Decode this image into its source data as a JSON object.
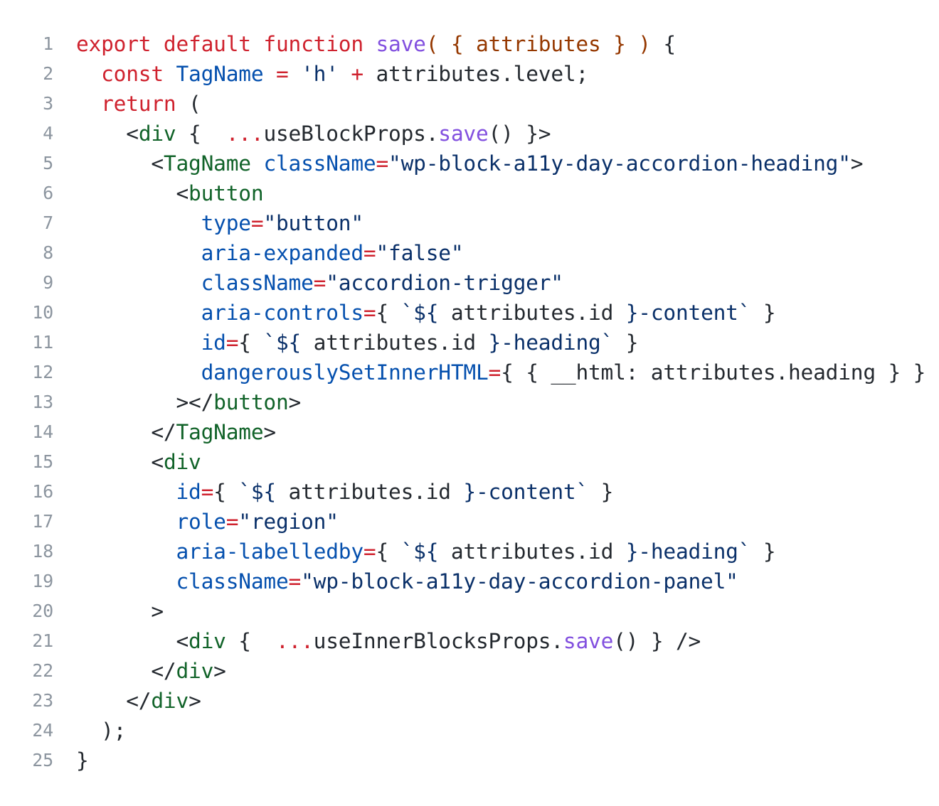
{
  "code": {
    "language": "jsx",
    "colors": {
      "kw": "#cf222e",
      "fn": "#8250df",
      "param": "#953800",
      "const": "#0550ae",
      "str": "#0a3069",
      "tag": "#116329",
      "attr": "#0550ae",
      "op": "#cf222e",
      "plain": "#24292f",
      "line_number": "#8c959f"
    },
    "lines": [
      {
        "n": "1",
        "tokens": [
          [
            "kw",
            "export default function "
          ],
          [
            "fn",
            "save"
          ],
          [
            "param",
            "( { attributes } ) "
          ],
          [
            "plain",
            "{"
          ]
        ]
      },
      {
        "n": "2",
        "tokens": [
          [
            "plain",
            "  "
          ],
          [
            "kw",
            "const "
          ],
          [
            "const",
            "TagName"
          ],
          [
            "op",
            " = "
          ],
          [
            "str",
            "'h'"
          ],
          [
            "op",
            " + "
          ],
          [
            "plain",
            "attributes.level;"
          ]
        ]
      },
      {
        "n": "3",
        "tokens": [
          [
            "plain",
            "  "
          ],
          [
            "kw",
            "return"
          ],
          [
            "plain",
            " ("
          ]
        ]
      },
      {
        "n": "4",
        "tokens": [
          [
            "plain",
            "    <"
          ],
          [
            "tag",
            "div"
          ],
          [
            "plain",
            " {  "
          ],
          [
            "op",
            "..."
          ],
          [
            "plain",
            "useBlockProps."
          ],
          [
            "fn",
            "save"
          ],
          [
            "plain",
            "() }>"
          ]
        ]
      },
      {
        "n": "5",
        "tokens": [
          [
            "plain",
            "      <"
          ],
          [
            "tag",
            "TagName"
          ],
          [
            "plain",
            " "
          ],
          [
            "attr",
            "className"
          ],
          [
            "op",
            "="
          ],
          [
            "str",
            "\"wp-block-a11y-day-accordion-heading\""
          ],
          [
            "plain",
            ">"
          ]
        ]
      },
      {
        "n": "6",
        "tokens": [
          [
            "plain",
            "        <"
          ],
          [
            "tag",
            "button"
          ]
        ]
      },
      {
        "n": "7",
        "tokens": [
          [
            "plain",
            "          "
          ],
          [
            "attr",
            "type"
          ],
          [
            "op",
            "="
          ],
          [
            "str",
            "\"button\""
          ]
        ]
      },
      {
        "n": "8",
        "tokens": [
          [
            "plain",
            "          "
          ],
          [
            "attr",
            "aria-expanded"
          ],
          [
            "op",
            "="
          ],
          [
            "str",
            "\"false\""
          ]
        ]
      },
      {
        "n": "9",
        "tokens": [
          [
            "plain",
            "          "
          ],
          [
            "attr",
            "className"
          ],
          [
            "op",
            "="
          ],
          [
            "str",
            "\"accordion-trigger\""
          ]
        ]
      },
      {
        "n": "10",
        "tokens": [
          [
            "plain",
            "          "
          ],
          [
            "attr",
            "aria-controls"
          ],
          [
            "op",
            "="
          ],
          [
            "plain",
            "{ "
          ],
          [
            "str",
            "`${"
          ],
          [
            "plain",
            " attributes.id "
          ],
          [
            "str",
            "}-content`"
          ],
          [
            "plain",
            " }"
          ]
        ]
      },
      {
        "n": "11",
        "tokens": [
          [
            "plain",
            "          "
          ],
          [
            "attr",
            "id"
          ],
          [
            "op",
            "="
          ],
          [
            "plain",
            "{ "
          ],
          [
            "str",
            "`${"
          ],
          [
            "plain",
            " attributes.id "
          ],
          [
            "str",
            "}-heading`"
          ],
          [
            "plain",
            " }"
          ]
        ]
      },
      {
        "n": "12",
        "tokens": [
          [
            "plain",
            "          "
          ],
          [
            "attr",
            "dangerouslySetInnerHTML"
          ],
          [
            "op",
            "="
          ],
          [
            "plain",
            "{ { __html: attributes.heading } }"
          ]
        ]
      },
      {
        "n": "13",
        "tokens": [
          [
            "plain",
            "        ></"
          ],
          [
            "tag",
            "button"
          ],
          [
            "plain",
            ">"
          ]
        ]
      },
      {
        "n": "14",
        "tokens": [
          [
            "plain",
            "      </"
          ],
          [
            "tag",
            "TagName"
          ],
          [
            "plain",
            ">"
          ]
        ]
      },
      {
        "n": "15",
        "tokens": [
          [
            "plain",
            "      <"
          ],
          [
            "tag",
            "div"
          ]
        ]
      },
      {
        "n": "16",
        "tokens": [
          [
            "plain",
            "        "
          ],
          [
            "attr",
            "id"
          ],
          [
            "op",
            "="
          ],
          [
            "plain",
            "{ "
          ],
          [
            "str",
            "`${"
          ],
          [
            "plain",
            " attributes.id "
          ],
          [
            "str",
            "}-content`"
          ],
          [
            "plain",
            " }"
          ]
        ]
      },
      {
        "n": "17",
        "tokens": [
          [
            "plain",
            "        "
          ],
          [
            "attr",
            "role"
          ],
          [
            "op",
            "="
          ],
          [
            "str",
            "\"region\""
          ]
        ]
      },
      {
        "n": "18",
        "tokens": [
          [
            "plain",
            "        "
          ],
          [
            "attr",
            "aria-labelledby"
          ],
          [
            "op",
            "="
          ],
          [
            "plain",
            "{ "
          ],
          [
            "str",
            "`${"
          ],
          [
            "plain",
            " attributes.id "
          ],
          [
            "str",
            "}-heading`"
          ],
          [
            "plain",
            " }"
          ]
        ]
      },
      {
        "n": "19",
        "tokens": [
          [
            "plain",
            "        "
          ],
          [
            "attr",
            "className"
          ],
          [
            "op",
            "="
          ],
          [
            "str",
            "\"wp-block-a11y-day-accordion-panel\""
          ]
        ]
      },
      {
        "n": "20",
        "tokens": [
          [
            "plain",
            "      >"
          ]
        ]
      },
      {
        "n": "21",
        "tokens": [
          [
            "plain",
            "        <"
          ],
          [
            "tag",
            "div"
          ],
          [
            "plain",
            " {  "
          ],
          [
            "op",
            "..."
          ],
          [
            "plain",
            "useInnerBlocksProps."
          ],
          [
            "fn",
            "save"
          ],
          [
            "plain",
            "() } />"
          ]
        ]
      },
      {
        "n": "22",
        "tokens": [
          [
            "plain",
            "      </"
          ],
          [
            "tag",
            "div"
          ],
          [
            "plain",
            ">"
          ]
        ]
      },
      {
        "n": "23",
        "tokens": [
          [
            "plain",
            "    </"
          ],
          [
            "tag",
            "div"
          ],
          [
            "plain",
            ">"
          ]
        ]
      },
      {
        "n": "24",
        "tokens": [
          [
            "plain",
            "  );"
          ]
        ]
      },
      {
        "n": "25",
        "tokens": [
          [
            "plain",
            "}"
          ]
        ]
      }
    ]
  }
}
